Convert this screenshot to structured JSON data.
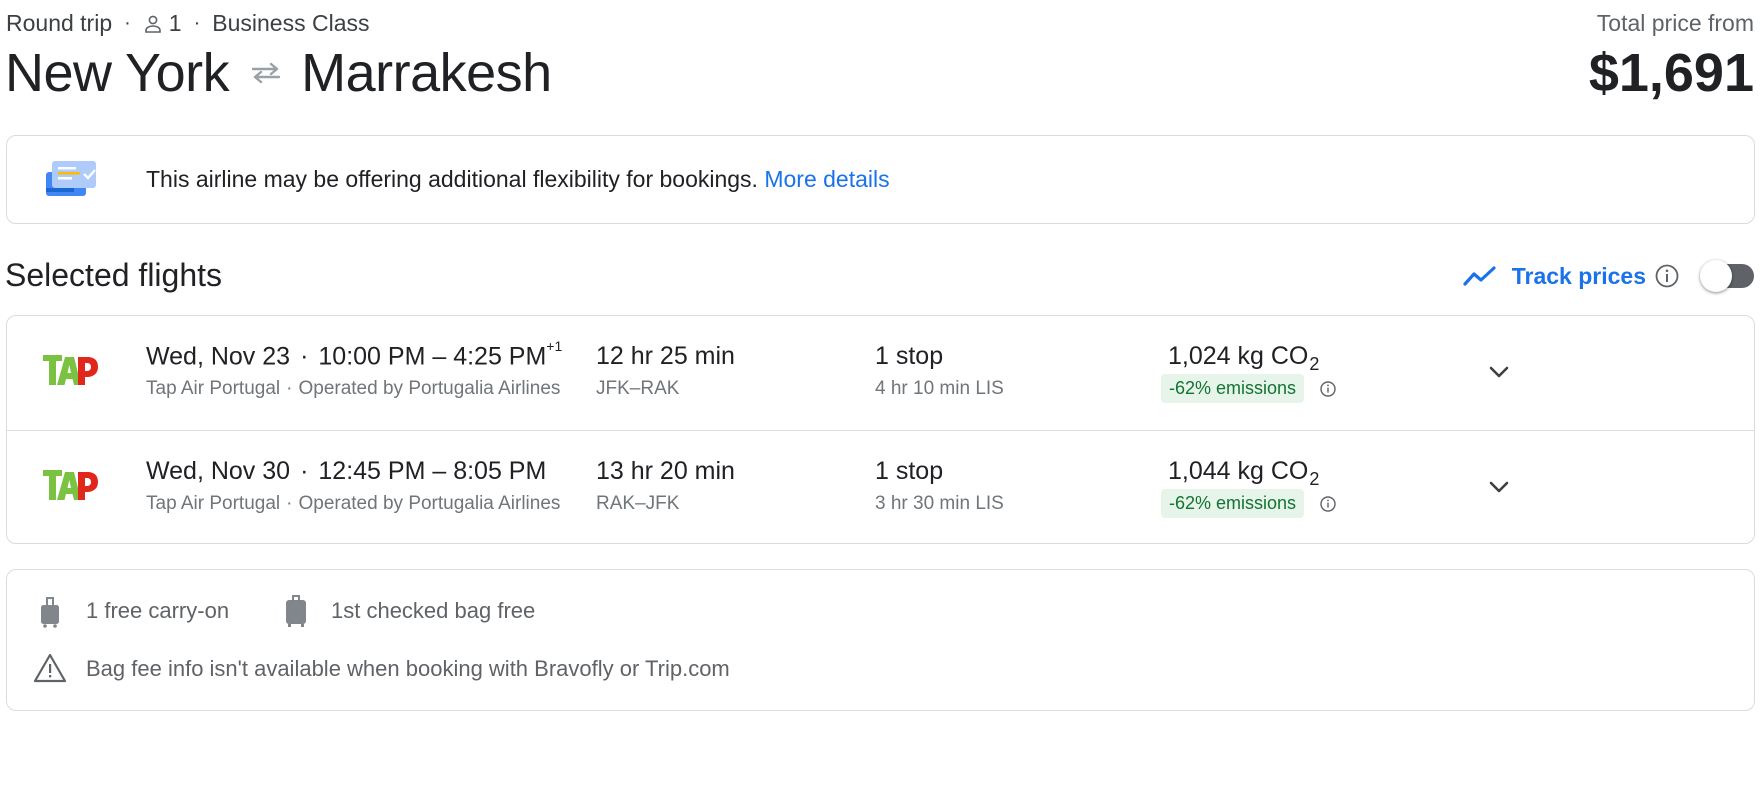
{
  "header": {
    "trip_type": "Round trip",
    "separator": "·",
    "passengers": "1",
    "cabin_class": "Business Class",
    "origin": "New York",
    "destination": "Marrakesh",
    "price_label": "Total price from",
    "price": "$1,691"
  },
  "notice": {
    "text": "This airline may be offering additional flexibility for bookings.",
    "link": "More details"
  },
  "selected_flights": {
    "title": "Selected flights",
    "track_prices_label": "Track prices",
    "track_prices_enabled": false,
    "flights": [
      {
        "date": "Wed, Nov 23",
        "time_range": "10:00 PM – 4:25 PM",
        "day_offset": "+1",
        "airline": "Tap Air Portugal",
        "operated_by": "Operated by Portugalia Airlines",
        "duration": "12 hr 25 min",
        "route": "JFK–RAK",
        "stops": "1 stop",
        "layover": "4 hr 10 min LIS",
        "co2_value": "1,024 kg CO",
        "co2_sub": "2",
        "emissions": "-62% emissions"
      },
      {
        "date": "Wed, Nov 30",
        "time_range": "12:45 PM – 8:05 PM",
        "day_offset": "",
        "airline": "Tap Air Portugal",
        "operated_by": "Operated by Portugalia Airlines",
        "duration": "13 hr 20 min",
        "route": "RAK–JFK",
        "stops": "1 stop",
        "layover": "3 hr 30 min LIS",
        "co2_value": "1,044 kg CO",
        "co2_sub": "2",
        "emissions": "-62% emissions"
      }
    ]
  },
  "bags": {
    "carry_on": "1 free carry-on",
    "checked": "1st checked bag free",
    "warning": "Bag fee info isn't available when booking with Bravofly or Trip.com"
  },
  "icons": {
    "person": "person-icon",
    "swap": "swap-arrows-icon",
    "notice": "booking-flexibility-icon",
    "track": "trend-line-icon",
    "info": "info-icon",
    "chevron": "chevron-down-icon",
    "carry_on": "carry-on-bag-icon",
    "checked_bag": "checked-bag-icon",
    "warning": "warning-triangle-icon",
    "airline_logo": "tap-logo"
  },
  "colors": {
    "link_blue": "#1a73e8",
    "emissions_bg": "#e6f4ea",
    "emissions_text": "#137333",
    "tap_green": "#7cc242",
    "tap_red": "#e1261c"
  }
}
